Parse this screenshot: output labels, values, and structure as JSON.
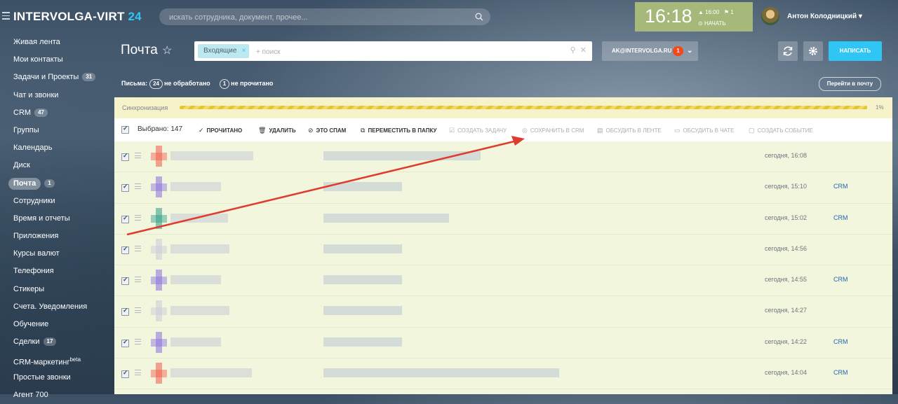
{
  "header": {
    "logo_text": "INTERVOLGA-VIRT",
    "logo_num": "24",
    "search_placeholder": "искать сотрудника, документ, прочее...",
    "clock": "16:18",
    "clock_alarm": "▲ 16:00",
    "clock_flag": "⚑ 1",
    "clock_start": "НАЧАТЬ",
    "user_name": "Антон Колодницкий"
  },
  "sidebar": {
    "items": [
      {
        "label": "Живая лента"
      },
      {
        "label": "Мои контакты"
      },
      {
        "label": "Задачи и Проекты",
        "count": "31"
      },
      {
        "label": "Чат и звонки"
      },
      {
        "label": "CRM",
        "count": "47"
      },
      {
        "label": "Группы"
      },
      {
        "label": "Календарь"
      },
      {
        "label": "Диск"
      },
      {
        "label": "Почта",
        "count": "1",
        "active": true
      },
      {
        "label": "Сотрудники"
      },
      {
        "label": "Время и отчеты"
      },
      {
        "label": "Приложения"
      },
      {
        "label": "Курсы валют"
      },
      {
        "label": "Телефония"
      },
      {
        "label": "Стикеры"
      },
      {
        "label": "Счета. Уведомления"
      },
      {
        "label": "Обучение"
      },
      {
        "label": "Сделки",
        "count": "17"
      },
      {
        "label": "CRM-маркетинг",
        "sup": "beta"
      },
      {
        "label": "Простые звонки"
      },
      {
        "label": "Агент 700"
      }
    ]
  },
  "page": {
    "title": "Почта",
    "star": "☆",
    "filter_chip": "Входящие",
    "filter_placeholder": "+ поиск",
    "account": "AK@INTERVOLGA.RU",
    "account_badge": "1",
    "write_label": "НАПИСАТЬ",
    "stats_prefix": "Письма:",
    "stats_unprocessed_count": "24",
    "stats_unprocessed_label": "не обработано",
    "stats_unread_count": "1",
    "stats_unread_label": "не прочитано",
    "go_mail_label": "Перейти в почту"
  },
  "sync": {
    "label": "Синхронизация",
    "percent_text": "1%",
    "progress": 0.01
  },
  "toolbar": {
    "selected": "Выбрано: 147",
    "actions": [
      {
        "label": "прочитано",
        "glyph": "✓",
        "enabled": true
      },
      {
        "label": "удалить",
        "glyph": "🗑",
        "enabled": true
      },
      {
        "label": "это спам",
        "glyph": "⊘",
        "enabled": true
      },
      {
        "label": "переместить в папку",
        "glyph": "⧉",
        "enabled": true
      },
      {
        "label": "создать задачу",
        "glyph": "☑",
        "enabled": false
      },
      {
        "label": "сохранить в crm",
        "glyph": "◎",
        "enabled": false
      },
      {
        "label": "обсудить в ленте",
        "glyph": "▤",
        "enabled": false
      },
      {
        "label": "обсудить в чате",
        "glyph": "▭",
        "enabled": false
      },
      {
        "label": "создать событие",
        "glyph": "▢",
        "enabled": false
      }
    ]
  },
  "rows": [
    {
      "date": "сегодня, 16:08",
      "crm": "",
      "color": "#f25a4a"
    },
    {
      "date": "сегодня, 15:10",
      "crm": "CRM",
      "color": "#8a6ee0"
    },
    {
      "date": "сегодня, 15:02",
      "crm": "CRM",
      "color": "#2a9d86"
    },
    {
      "date": "сегодня, 14:56",
      "crm": "",
      "color": "#c8cad8"
    },
    {
      "date": "сегодня, 14:55",
      "crm": "CRM",
      "color": "#8a6ee0"
    },
    {
      "date": "сегодня, 14:27",
      "crm": "",
      "color": "#c8cad8"
    },
    {
      "date": "сегодня, 14:22",
      "crm": "CRM",
      "color": "#8a6ee0"
    },
    {
      "date": "сегодня, 14:04",
      "crm": "CRM",
      "color": "#f25a4a"
    }
  ]
}
